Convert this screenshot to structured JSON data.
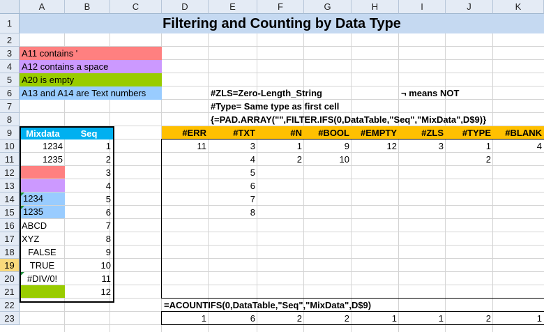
{
  "columns": [
    "A",
    "B",
    "C",
    "D",
    "E",
    "F",
    "G",
    "H",
    "I",
    "J",
    "K"
  ],
  "rows": [
    "1",
    "2",
    "3",
    "4",
    "5",
    "6",
    "7",
    "8",
    "9",
    "10",
    "11",
    "12",
    "13",
    "14",
    "15",
    "16",
    "17",
    "18",
    "19",
    "20",
    "21",
    "22",
    "23"
  ],
  "title": "Filtering and Counting by Data Type",
  "legend": {
    "a11": "A11 contains '",
    "a12": "A12 contains a space",
    "a20": " A20 is empty",
    "a13": "A13 and A14 are Text numbers"
  },
  "notes": {
    "zls": "#ZLS=Zero-Length_String",
    "not": "¬ means NOT",
    "type": "#Type= Same type as first cell",
    "formula1": "{=PAD.ARRAY(\"\",FILTER.IFS(0,DataTable,\"Seq\",\"MixData\",D$9)}",
    "formula2": "=ACOUNTIFS(0,DataTable,\"Seq\",\"MixData\",D$9)"
  },
  "table": {
    "headers": [
      "Mixdata",
      "Seq"
    ],
    "mixdata": [
      "1234",
      "1235",
      "",
      "",
      "1234",
      "1235",
      "ABCD",
      "XYZ",
      "FALSE",
      "TRUE",
      "#DIV/0!",
      ""
    ],
    "seq": [
      "1",
      "2",
      "3",
      "4",
      "5",
      "6",
      "7",
      "8",
      "9",
      "10",
      "11",
      "12"
    ]
  },
  "result_headers": [
    "#ERR",
    "#TXT",
    "#N",
    "#BOOL",
    "#EMPTY",
    "#ZLS",
    "#TYPE",
    "#BLANK"
  ],
  "result_rows": [
    [
      "11",
      "3",
      "1",
      "9",
      "12",
      "3",
      "1",
      "4"
    ],
    [
      "",
      "4",
      "2",
      "10",
      "",
      "",
      "2",
      ""
    ],
    [
      "",
      "5",
      "",
      "",
      "",
      "",
      "",
      ""
    ],
    [
      "",
      "6",
      "",
      "",
      "",
      "",
      "",
      ""
    ],
    [
      "",
      "7",
      "",
      "",
      "",
      "",
      "",
      ""
    ],
    [
      "",
      "8",
      "",
      "",
      "",
      "",
      "",
      ""
    ]
  ],
  "counts": [
    "1",
    "6",
    "2",
    "2",
    "1",
    "1",
    "2",
    "1"
  ],
  "colors": {
    "pink": "#ff8080",
    "purple": "#cc99ff",
    "green": "#99cc00",
    "blue": "#99ccff",
    "table_header": "#00b0f0",
    "result_header": "#ffc000",
    "title_bg": "#c5d9f1"
  },
  "icons": [
    "error-triangle-indicator-icon"
  ]
}
